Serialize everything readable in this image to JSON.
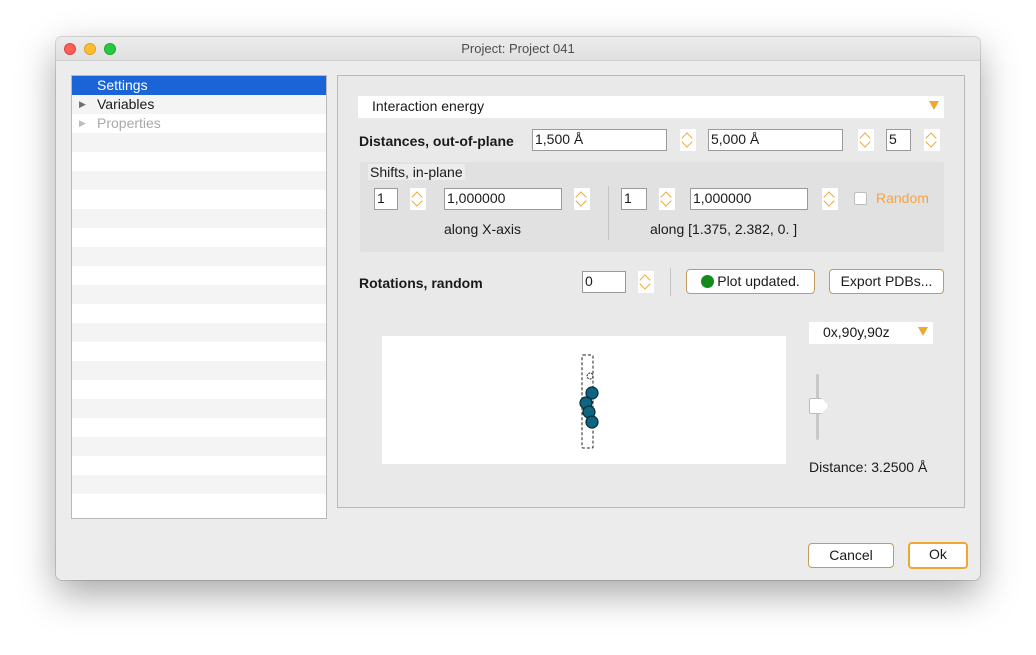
{
  "window": {
    "title": "Project: Project 041"
  },
  "tree": {
    "items": [
      {
        "label": "Settings",
        "state": "selected",
        "has_arrow": false
      },
      {
        "label": "Variables",
        "state": "normal",
        "has_arrow": true
      },
      {
        "label": "Properties",
        "state": "disabled",
        "has_arrow": true
      }
    ]
  },
  "settings": {
    "mode": "Interaction energy",
    "distances": {
      "label": "Distances, out-of-plane",
      "start": "1,500 Å",
      "end": "5,000 Å",
      "count": "5"
    },
    "shifts": {
      "title": "Shifts, in-plane",
      "x": {
        "count": "1",
        "step": "1,000000",
        "label": "along X-axis"
      },
      "y": {
        "count": "1",
        "step": "1,000000",
        "label": "along [1.375, 2.382, 0.   ]"
      },
      "random_label": "Random"
    },
    "rotations": {
      "label": "Rotations, random",
      "count": "0"
    },
    "status": "Plot updated.",
    "export_label": "Export PDBs...",
    "view": "0x,90y,90z",
    "distance_readout": "Distance: 3.2500 Å"
  },
  "footer": {
    "cancel_label": "Cancel",
    "ok_label": "Ok"
  },
  "colors": {
    "accent": "#f0a732",
    "selection": "#1a64d8",
    "status_ok": "#128a1c",
    "atom": "#0d6581"
  }
}
